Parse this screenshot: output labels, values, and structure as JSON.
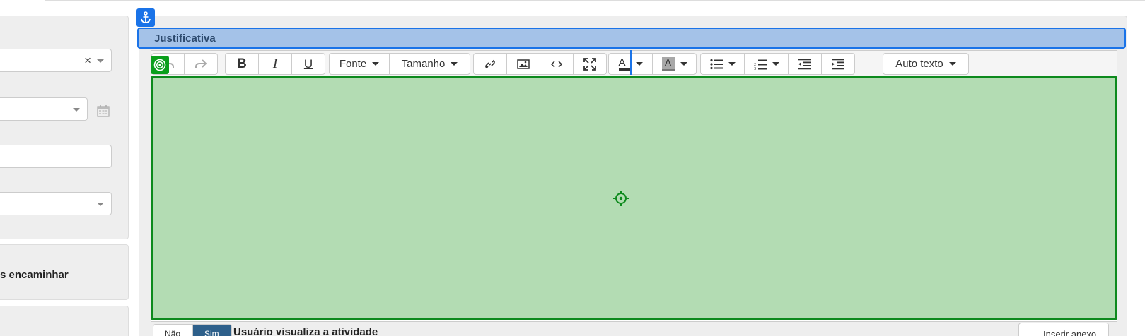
{
  "sidebar": {
    "forward_label": "s encaminhar"
  },
  "section": {
    "title": "Justificativa"
  },
  "toolbar": {
    "font_label": "Fonte",
    "size_label": "Tamanho",
    "autotext_label": "Auto texto"
  },
  "bottom": {
    "toggle_no": "Não",
    "toggle_yes": "Sim",
    "visibility_label": "Usuário visualiza a atividade",
    "right_button": "Inserir anexo"
  },
  "colors": {
    "header_bg": "#a4c2e8",
    "accent_blue": "#1a73e8",
    "content_green": "#b3dcb3",
    "focus_green": "#0d8a1d"
  },
  "icons": [
    "anchor-icon",
    "target-icon",
    "undo-icon",
    "redo-icon",
    "bold-icon",
    "italic-icon",
    "underline-icon",
    "link-icon",
    "image-icon",
    "code-icon",
    "fullscreen-icon",
    "font-color-icon",
    "highlight-color-icon",
    "bullet-list-icon",
    "numbered-list-icon",
    "outdent-icon",
    "indent-icon",
    "calendar-icon",
    "crosshair-icon"
  ]
}
